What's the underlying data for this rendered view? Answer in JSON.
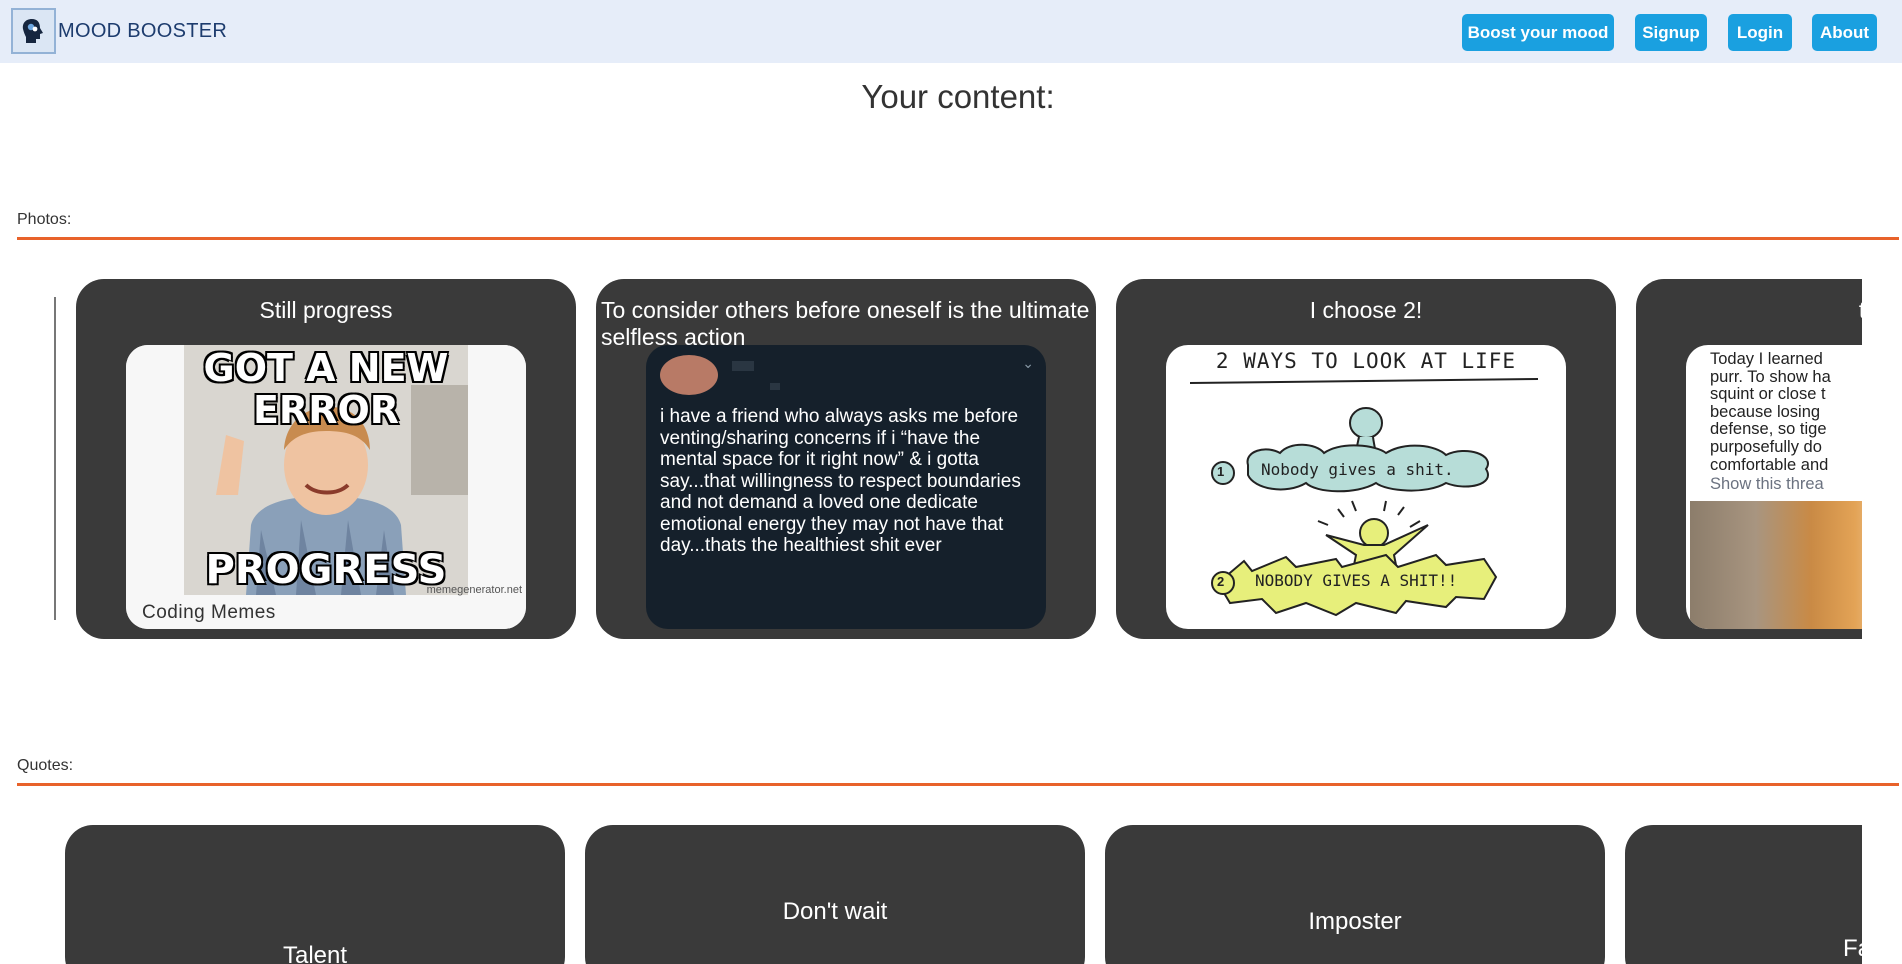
{
  "nav": {
    "brand": "MOOD BOOSTER",
    "buttons": [
      "Boost your mood",
      "Signup",
      "Login",
      "About"
    ]
  },
  "page": {
    "title": "Your content:"
  },
  "photos": {
    "label": "Photos:",
    "cards": [
      {
        "title": "Still progress",
        "meme_top": "GOT A NEW ERROR",
        "meme_bottom": "PROGRESS",
        "watermark": "memegenerator.net",
        "caption": "Coding Memes"
      },
      {
        "title": "To consider others before oneself is the ultimate selfless action",
        "tweet": "i have a friend who always asks me before venting/sharing concerns if i “have the mental space for it right now” & i gotta say...that willingness to respect boundaries and not demand a loved one dedicate emotional energy they may not have that day...thats the healthiest shit ever"
      },
      {
        "title": "I choose 2!",
        "heading": "2 WAYS TO LOOK AT LIFE",
        "way1": "Nobody gives a shit.",
        "way2": "NOBODY GIVES A SHIT!!",
        "num1": "1",
        "num2": "2"
      },
      {
        "title": "that's",
        "text_lines": [
          "Today I learned",
          "purr. To show ha",
          "squint or close t",
          "because losing",
          "defense, so tige",
          "purposefully do",
          "comfortable and"
        ],
        "link": "Show this threa"
      }
    ]
  },
  "quotes": {
    "label": "Quotes:",
    "cards": [
      "Talent",
      "Don't wait",
      "Imposter",
      "Fa"
    ]
  },
  "colors": {
    "accent_line": "#e8622a",
    "nav_button": "#1aa0e0",
    "card": "#3a3a3a",
    "nav_bg": "#e6edf9"
  }
}
